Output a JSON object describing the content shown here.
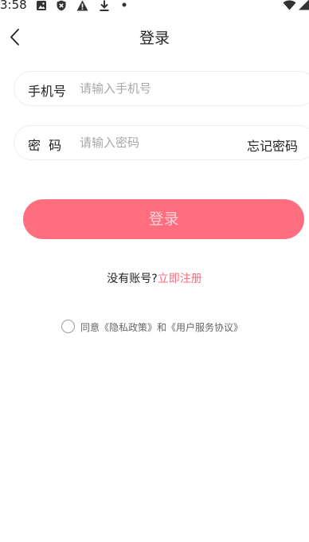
{
  "status_bar": {
    "time": "3:58",
    "icons": [
      "image-icon",
      "shield-icon",
      "warning-icon",
      "download-icon",
      "dot-icon",
      "wifi-icon",
      "signal-icon"
    ]
  },
  "nav": {
    "back_icon": "chevron-left-icon",
    "title": "登录"
  },
  "form": {
    "phone": {
      "label": "手机号",
      "placeholder": "请输入手机号",
      "value": ""
    },
    "password": {
      "label": "密  码",
      "placeholder": "请输入密码",
      "value": "",
      "forgot_label": "忘记密码"
    },
    "login_label": "登录"
  },
  "register": {
    "prompt": "没有账号?",
    "link_label": "立即注册"
  },
  "agreement": {
    "checked": false,
    "prefix": "同意",
    "privacy_label": "《隐私政策》",
    "joiner": "和",
    "terms_label": "《用户服务协议》"
  },
  "colors": {
    "accent": "#fe6e7e",
    "accent_text": "#fd6b7b",
    "border": "#ededed",
    "placeholder": "#a8a8a8"
  }
}
